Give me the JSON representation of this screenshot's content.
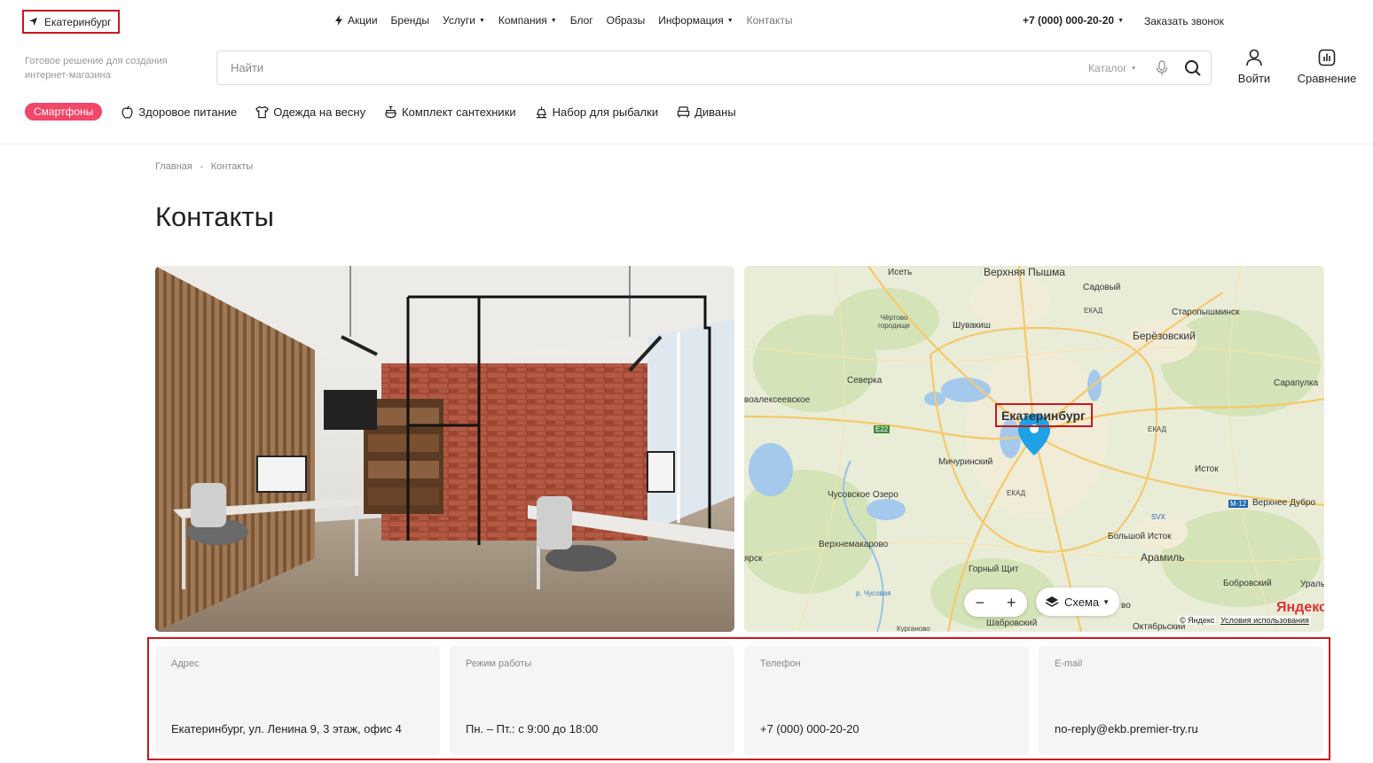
{
  "topbar": {
    "city": "Екатеринбург",
    "nav": [
      {
        "label": "Акции",
        "icon": "bolt-icon",
        "dropdown": false,
        "active": false
      },
      {
        "label": "Бренды",
        "dropdown": false,
        "active": false
      },
      {
        "label": "Услуги",
        "dropdown": true,
        "active": false
      },
      {
        "label": "Компания",
        "dropdown": true,
        "active": false
      },
      {
        "label": "Блог",
        "dropdown": false,
        "active": false
      },
      {
        "label": "Образы",
        "dropdown": false,
        "active": false
      },
      {
        "label": "Информация",
        "dropdown": true,
        "active": false
      },
      {
        "label": "Контакты",
        "dropdown": false,
        "active": true
      }
    ],
    "phone": "+7 (000) 000-20-20",
    "callback": "Заказать звонок"
  },
  "header": {
    "tagline": "Готовое решение для создания интернет-магазина",
    "search_placeholder": "Найти",
    "catalog_label": "Каталог",
    "login_label": "Войти",
    "compare_label": "Сравнение"
  },
  "categories": {
    "pill": "Смартфоны",
    "items": [
      {
        "label": "Здоровое питание",
        "icon": "apple-icon"
      },
      {
        "label": "Одежда на весну",
        "icon": "tshirt-icon"
      },
      {
        "label": "Комплект сантехники",
        "icon": "faucet-icon"
      },
      {
        "label": "Набор для рыбалки",
        "icon": "fishing-icon"
      },
      {
        "label": "Диваны",
        "icon": "sofa-icon"
      }
    ]
  },
  "breadcrumb": [
    "Главная",
    "Контакты"
  ],
  "page_title": "Контакты",
  "map": {
    "labels": {
      "iset": "Исеть",
      "pyshma": "Верхняя Пышма",
      "sadovy": "Садовый",
      "chertovo": "Чёртово городище",
      "shuvakish": "Шувакиш",
      "ekad1": "ЕКАД",
      "staropyshminsk": "Старопышминск",
      "berezovsky": "Берёзовский",
      "severka": "Северка",
      "sarapulka": "Сарапулка",
      "novoalekseevskoe": "воалексеевское",
      "city": "Екатеринбург",
      "e22": "E22",
      "ekad2": "ЕКАД",
      "michurinsky": "Мичуринский",
      "istok": "Исток",
      "chusovskoe": "Чусовское Озеро",
      "svx": "SVX",
      "m12": "M-12",
      "verkhnee_dubrovo": "Верхнее Дубро",
      "bolshoy_istok": "Большой Исток",
      "verkhnemakarovo": "Верхнемакарово",
      "aramil": "Арамиль",
      "yarsk": "ярск",
      "gorny_shchit": "Горный Щит",
      "bobrovsky": "Бобровский",
      "ural": "Ураль",
      "chusovaya": "р. Чусовая",
      "vo": "во",
      "shabrovsky": "Шабровский",
      "kurganovo": "Курганово",
      "oktyabrsky": "Октябрьский",
      "ekad3": "ЕКАД"
    },
    "zoom_minus": "−",
    "zoom_plus": "+",
    "layer_label": "Схема",
    "logo": "Яндекс",
    "copyright": "© Яндекс",
    "terms": "Условия использования"
  },
  "contacts": [
    {
      "label": "Адрес",
      "value": "Екатеринбург, ул. Ленина 9, 3 этаж, офис 4"
    },
    {
      "label": "Режим работы",
      "value": "Пн. – Пт.: с 9:00 до 18:00"
    },
    {
      "label": "Телефон",
      "value": "+7 (000) 000-20-20"
    },
    {
      "label": "E-mail",
      "value": "no-reply@ekb.premier-try.ru"
    }
  ],
  "colors": {
    "accent_pill": "#f2466b",
    "highlight_frame": "#c8171c",
    "map_pin": "#1ea1e5"
  }
}
